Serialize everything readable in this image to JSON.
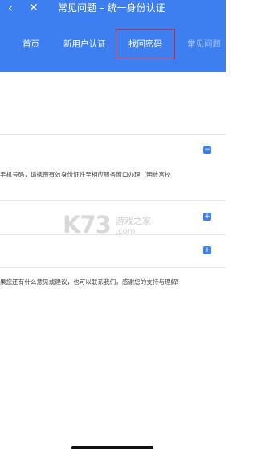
{
  "topbar": {
    "back_glyph": "‹",
    "close_glyph": "✕",
    "title": "常见问题 – 统一身份认证"
  },
  "nav": {
    "items": [
      "首页",
      "新用户认证",
      "找回密码",
      "常见问题"
    ],
    "selected": "找回密码"
  },
  "faq": {
    "expanded_text": "手机号码，请携带有效身份证件至相应服务窗口办理（明放宫校",
    "collapse_glyph": "−",
    "expand_glyph": "+",
    "footer_text": "果您还有什么意见或建议，也可以联系我们，感谢您的支持与理解!"
  },
  "watermark": {
    "brand": "K73",
    "cn": "游戏之家",
    "url": ".com"
  },
  "colors": {
    "primary": "#3d7ef0",
    "highlight_border": "#d9262c"
  }
}
